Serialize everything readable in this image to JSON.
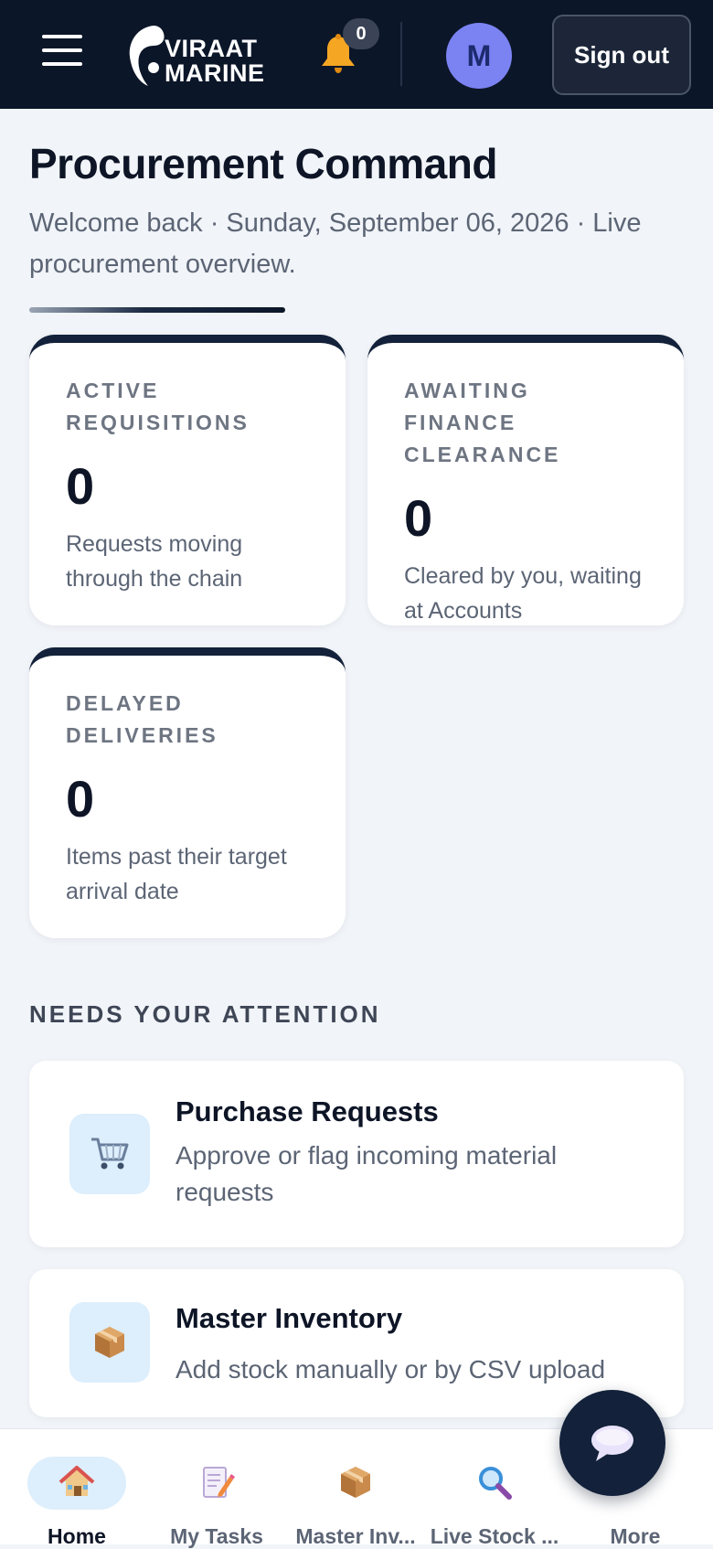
{
  "header": {
    "brand_line1": "VIRAAT",
    "brand_line2": "MARINE",
    "notification_count": "0",
    "avatar_initial": "M",
    "sign_out_label": "Sign out",
    "icons": {
      "menu": "hamburger-menu-icon",
      "notifications": "bell-icon"
    }
  },
  "page": {
    "title": "Procurement Command",
    "subtitle": "Welcome back  ·  Sunday, September 06, 2026  ·  Live procurement overview."
  },
  "stats": [
    {
      "label": "ACTIVE REQUISITIONS",
      "value": "0",
      "description": "Requests moving through the chain"
    },
    {
      "label": "AWAITING FINANCE CLEARANCE",
      "value": "0",
      "description": "Cleared by you, waiting at Accounts"
    },
    {
      "label": "DELAYED DELIVERIES",
      "value": "0",
      "description": "Items past their target arrival date"
    }
  ],
  "attention": {
    "heading": "NEEDS YOUR ATTENTION",
    "items": [
      {
        "icon": "shopping-cart-icon",
        "title": "Purchase Requests",
        "description": "Approve or flag incoming material requests"
      },
      {
        "icon": "package-icon",
        "title": "Master Inventory",
        "description": "Add stock manually or by CSV upload"
      }
    ]
  },
  "bottom_nav": {
    "active": "Home",
    "items": [
      {
        "label": "Home",
        "icon": "home-icon"
      },
      {
        "label": "My Tasks",
        "icon": "memo-icon"
      },
      {
        "label": "Master Inv...",
        "icon": "package-icon"
      },
      {
        "label": "Live Stock ...",
        "icon": "magnifier-icon"
      },
      {
        "label": "More",
        "icon": "more-icon"
      }
    ]
  },
  "chat": {
    "icon": "chat-bubble-icon"
  },
  "colors": {
    "header_bg": "#0c1629",
    "page_bg": "#f1f4f8",
    "card_accent": "#13213a",
    "avatar_bg": "#7b83f2",
    "icon_tile_bg": "#ddeefc",
    "bell": "#f5a623"
  }
}
